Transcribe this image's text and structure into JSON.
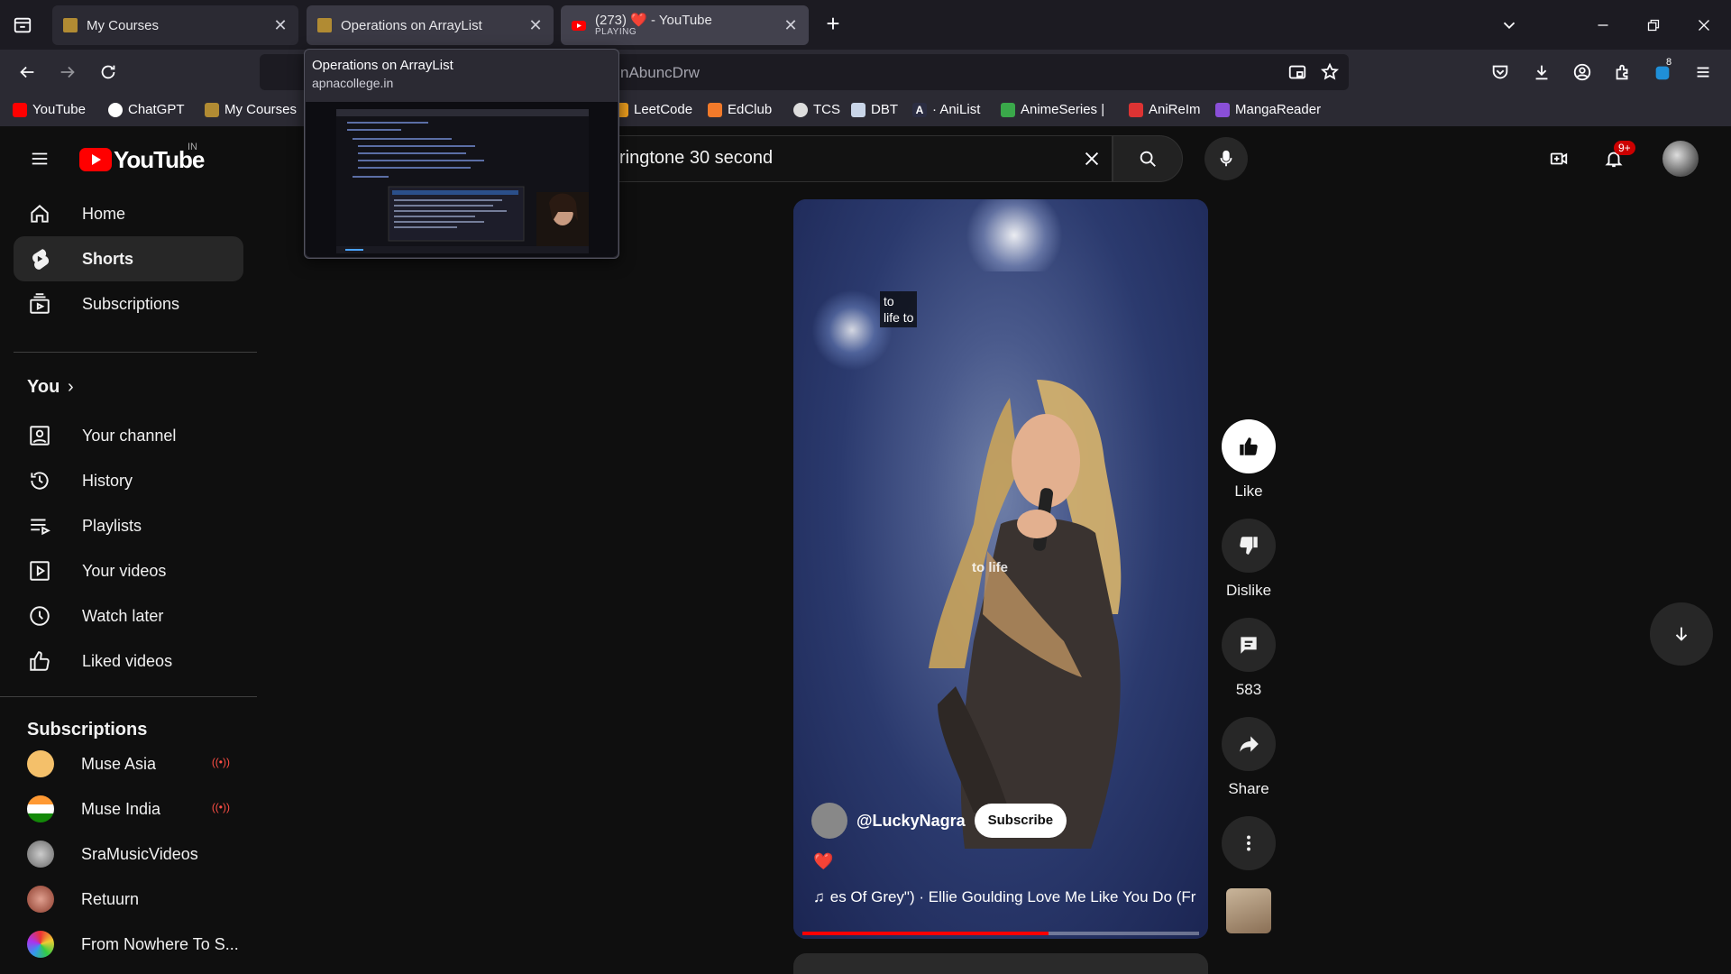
{
  "browser": {
    "tabs": [
      {
        "title": "My Courses",
        "status": ""
      },
      {
        "title": "Operations on ArrayList",
        "status": ""
      },
      {
        "title": "(273) ❤️ - YouTube",
        "status": "PLAYING"
      }
    ],
    "url_fragment": "nAbuncDrw",
    "tooltip": {
      "title": "Operations on ArrayList",
      "host": "apnacollege.in"
    },
    "bookmarks": [
      "YouTube",
      "ChatGPT",
      "My Courses",
      "LeetCode",
      "EdClub",
      "TCS",
      "DBT",
      "· AniList",
      "AnimeSeries |",
      "AniReIm",
      "MangaReader"
    ],
    "extension_badge": "8"
  },
  "youtube": {
    "logo": "YouTube",
    "country": "IN",
    "search_value": "ringtone 30 second",
    "notifications": "9+",
    "nav": [
      {
        "label": "Home",
        "icon": "home-icon"
      },
      {
        "label": "Shorts",
        "icon": "shorts-icon"
      },
      {
        "label": "Subscriptions",
        "icon": "subscriptions-icon"
      }
    ],
    "you_heading": "You",
    "you_items": [
      {
        "label": "Your channel",
        "icon": "your-channel-icon"
      },
      {
        "label": "History",
        "icon": "history-icon"
      },
      {
        "label": "Playlists",
        "icon": "playlists-icon"
      },
      {
        "label": "Your videos",
        "icon": "your-videos-icon"
      },
      {
        "label": "Watch later",
        "icon": "watch-later-icon"
      },
      {
        "label": "Liked videos",
        "icon": "liked-videos-icon"
      }
    ],
    "subs_heading": "Subscriptions",
    "subscriptions": [
      {
        "name": "Muse Asia",
        "live": true,
        "color": "#f4c06a"
      },
      {
        "name": "Muse India",
        "live": true,
        "color": "#d9c27a"
      },
      {
        "name": "SraMusicVideos",
        "live": false,
        "color": "#8a8a8a"
      },
      {
        "name": "Retuurn",
        "live": false,
        "color": "#b0594a"
      },
      {
        "name": "From Nowhere To S...",
        "live": false,
        "color": "#5a9a3a"
      }
    ],
    "short": {
      "caption_line1": "to",
      "caption_line2": "life to",
      "burned_subtitle": "to life",
      "channel": "@LuckyNagra",
      "subscribe": "Subscribe",
      "emoji": "❤️",
      "music": "es Of Grey\") · Ellie Goulding    Love Me Like You Do (Fr",
      "progress": 0.62
    },
    "actions": {
      "like": "Like",
      "dislike": "Dislike",
      "comments": "583",
      "share": "Share"
    }
  },
  "colors": {
    "accent_red": "#ff0000",
    "chrome_bg": "#1c1b22",
    "chrome_toolbar": "#2b2a33",
    "yt_bg": "#0f0f0f"
  }
}
